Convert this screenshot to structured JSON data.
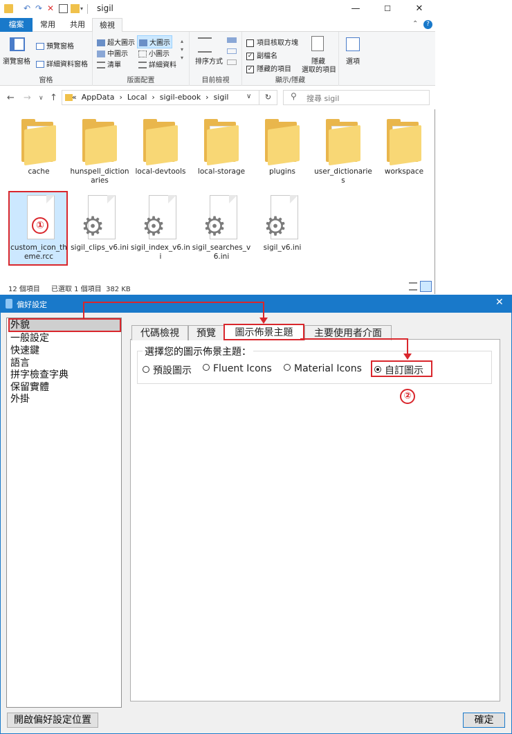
{
  "explorer": {
    "title": "sigil",
    "tabs": [
      "檔案",
      "常用",
      "共用",
      "檢視"
    ],
    "ribbon": {
      "pane": {
        "navpane": "瀏覽窗格",
        "preview": "預覽窗格",
        "details": "詳細資料窗格",
        "label": "窗格"
      },
      "layout": {
        "xl": "超大圖示",
        "large": "大圖示",
        "medium": "中圖示",
        "small": "小圖示",
        "list": "清單",
        "detail": "詳細資料",
        "label": "版面配置"
      },
      "view": {
        "sort": "排序方式",
        "label": "目前檢視"
      },
      "showhide": {
        "checkboxes": "項目核取方塊",
        "ext": "副檔名",
        "hidden": "隱藏的項目",
        "hide_sel_1": "隱藏",
        "hide_sel_2": "選取的項目",
        "label": "顯示/隱藏"
      },
      "options": "選項"
    },
    "address": "«  AppData  ›  Local  ›  sigil-ebook  ›  sigil",
    "search_placeholder": "搜尋 sigil",
    "items": [
      {
        "name": "cache"
      },
      {
        "name": "hunspell_dictionaries"
      },
      {
        "name": "local-devtools"
      },
      {
        "name": "local-storage"
      },
      {
        "name": "plugins"
      },
      {
        "name": "user_dictionaries"
      },
      {
        "name": "workspace"
      },
      {
        "name": "custom_icon_theme.rcc"
      },
      {
        "name": "sigil_clips_v6.ini"
      },
      {
        "name": "sigil_index_v6.ini"
      },
      {
        "name": "sigil_searches_v6.ini"
      },
      {
        "name": "sigil_v6.ini"
      }
    ],
    "status": {
      "count": "12 個項目",
      "selected": "已選取 1 個項目  382 KB"
    }
  },
  "prefs": {
    "title": "偏好設定",
    "left_items": [
      "外貌",
      "一般設定",
      "快速鍵",
      "語言",
      "拼字檢查字典",
      "保留實體",
      "外掛"
    ],
    "tabs": [
      "代碼檢視",
      "預覽",
      "圖示佈景主題",
      "主要使用者介面"
    ],
    "group_label": "選擇您的圖示佈景主題：",
    "radios": [
      "預設圖示",
      "Fluent Icons",
      "Material Icons",
      "自訂圖示"
    ],
    "open_location_button": "開啟偏好設定位置",
    "ok_button": "確定"
  },
  "annotations": {
    "one": "①",
    "two": "②"
  },
  "colors": {
    "accent": "#1979ca",
    "highlight": "#d9262c",
    "selection": "#cce8ff",
    "folder": "#f8d775"
  }
}
